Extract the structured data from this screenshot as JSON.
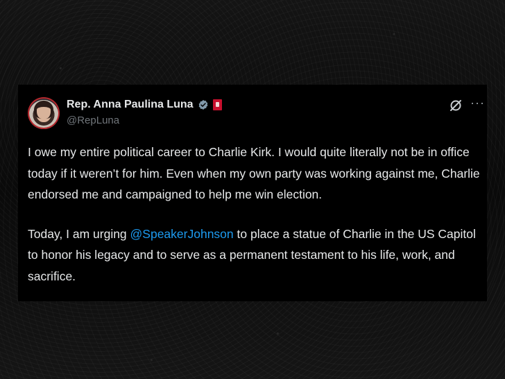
{
  "tweet": {
    "display_name": "Rep. Anna Paulina Luna",
    "handle": "@RepLuna",
    "paragraph1": "I owe my entire political career to Charlie Kirk. I would quite literally not be in office today if it weren’t for him. Even when my own party was working against me, Charlie endorsed me and campaigned to help me win election.",
    "paragraph2_before": "Today, I am urging ",
    "paragraph2_mention": "@SpeakerJohnson",
    "paragraph2_after": " to place a statue of Charlie in the US Capitol to honor his legacy and to serve as a permanent testament to his life, work, and sacrifice.",
    "more_label": "···"
  },
  "icons": {
    "verified": "verified-badge-icon",
    "flag": "government-flag-icon",
    "grok": "grok-icon",
    "more": "more-options-icon"
  },
  "colors": {
    "background": "#000000",
    "text": "#e7e9ea",
    "secondary": "#71767b",
    "mention": "#1d9bf0",
    "verified": "#829aab",
    "flag": "#c8102e"
  }
}
